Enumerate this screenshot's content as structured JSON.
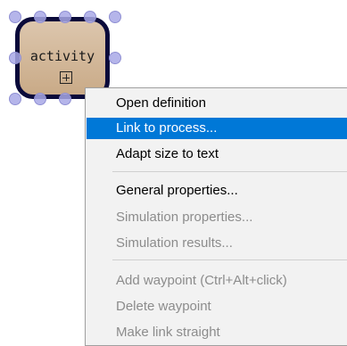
{
  "diagram": {
    "activity_label": "activity"
  },
  "context_menu": {
    "items": [
      {
        "label": "Open definition",
        "state": "normal"
      },
      {
        "label": "Link to process...",
        "state": "highlighted"
      },
      {
        "label": "Adapt size to text",
        "state": "normal"
      },
      {
        "label": "General properties...",
        "state": "normal"
      },
      {
        "label": "Simulation properties...",
        "state": "disabled"
      },
      {
        "label": "Simulation results...",
        "state": "disabled"
      },
      {
        "label": "Add waypoint (Ctrl+Alt+click)",
        "state": "disabled"
      },
      {
        "label": "Delete waypoint",
        "state": "disabled"
      },
      {
        "label": "Make link straight",
        "state": "disabled"
      }
    ]
  },
  "colors": {
    "highlight": "#0078d7",
    "disabled_text": "#8c8c8c",
    "node_border": "#0a0a3a",
    "node_fill": "#d6bb9c",
    "selection_handle": "#a8a8e6"
  }
}
